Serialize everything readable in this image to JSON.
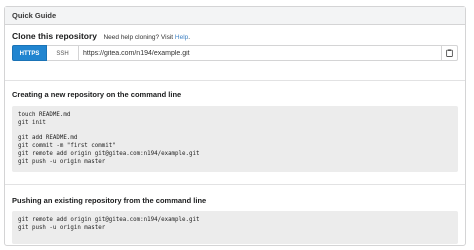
{
  "header": {
    "title": "Quick Guide"
  },
  "clone": {
    "title": "Clone this repository",
    "help_prefix": "Need help cloning? Visit",
    "help_link": "Help",
    "help_suffix": ".",
    "https_label": "HTTPS",
    "ssh_label": "SSH",
    "url": "https://gitea.com/n194/example.git",
    "copy_icon": "clipboard-icon"
  },
  "create": {
    "title": "Creating a new repository on the command line",
    "code": "touch README.md\ngit init\n\ngit add README.md\ngit commit -m \"first commit\"\ngit remote add origin git@gitea.com:n194/example.git\ngit push -u origin master"
  },
  "push": {
    "title": "Pushing an existing repository from the command line",
    "code": "git remote add origin git@gitea.com:n194/example.git\ngit push -u origin master"
  },
  "colors": {
    "accent": "#2185d0",
    "link": "#4183c4",
    "code_bg": "#ececec"
  }
}
